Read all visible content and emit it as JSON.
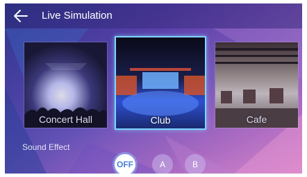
{
  "header": {
    "title": "Live Simulation",
    "back_icon": "arrow-left-icon"
  },
  "venues": [
    {
      "label": "Concert Hall",
      "selected": false
    },
    {
      "label": "Club",
      "selected": true
    },
    {
      "label": "Cafe",
      "selected": false
    }
  ],
  "sound_effect": {
    "label": "Sound Effect",
    "options": [
      {
        "label": "OFF",
        "active": true
      },
      {
        "label": "A",
        "active": false
      },
      {
        "label": "B",
        "active": false
      }
    ]
  },
  "colors": {
    "accent": "#7fd3ff",
    "active_text": "#4a7fd8"
  }
}
